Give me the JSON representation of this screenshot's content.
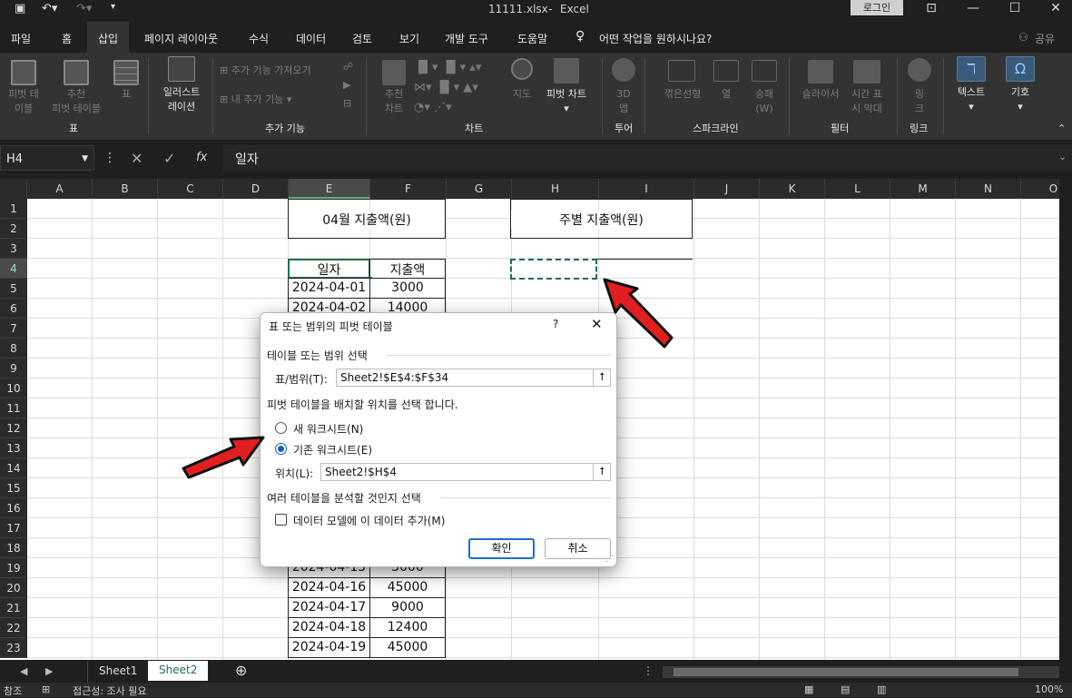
{
  "window": {
    "title_file": "11111.xlsx",
    "title_sep": "-",
    "title_app": "Excel",
    "login_label": "로그인"
  },
  "menu": {
    "items": [
      "파일",
      "홈",
      "삽입",
      "페이지 레이아웃",
      "수식",
      "데이터",
      "검토",
      "보기",
      "개발 도구",
      "도움말"
    ],
    "active": "삽입",
    "tell_me": "어떤 작업을 원하시나요?",
    "share": "공유"
  },
  "ribbon": {
    "pivot_table": "피벗 테\n이블",
    "recommended_pivot": "추천\n피벗 테이블",
    "table": "표",
    "illustrations": "일러스트\n레이션",
    "get_addins": "추가 기능 가져오기",
    "my_addins": "내 추가 기능",
    "recommended_charts": "추천\n차트",
    "maps": "지도",
    "pivot_chart": "피벗 차트",
    "map3d": "3D\n맵",
    "line": "꺾은선형",
    "column": "열",
    "winloss": "승패\n(W)",
    "slicer": "슬라이서",
    "timeline": "시간 표\n시 막대",
    "link": "링\n크",
    "text": "텍스트",
    "symbols": "기호",
    "groups": {
      "tables": "표",
      "addins": "추가 기능",
      "charts": "차트",
      "tours": "투어",
      "sparklines": "스파크라인",
      "filters": "필터",
      "links": "링크"
    }
  },
  "formula_bar": {
    "name_box": "H4",
    "fx": "fx",
    "content": "일자"
  },
  "grid": {
    "columns": [
      "A",
      "B",
      "C",
      "D",
      "E",
      "F",
      "G",
      "H",
      "I",
      "J",
      "K",
      "L",
      "M",
      "N",
      "O"
    ],
    "rows": [
      "1",
      "2",
      "3",
      "4",
      "5",
      "6",
      "7",
      "8",
      "9",
      "10",
      "11",
      "12",
      "13",
      "14",
      "15",
      "16",
      "17",
      "18",
      "19",
      "20",
      "21",
      "22",
      "23"
    ],
    "title_left": "04월 지출액(원)",
    "title_right": "주별 지출액(원)",
    "header_date": "일자",
    "header_amount": "지출액",
    "data_top": [
      {
        "date": "2024-04-01",
        "amount": "3000"
      },
      {
        "date": "2024-04-02",
        "amount": "14000"
      }
    ],
    "data_bottom": [
      {
        "date": "2024-04-15",
        "amount": "3000"
      },
      {
        "date": "2024-04-16",
        "amount": "45000"
      },
      {
        "date": "2024-04-17",
        "amount": "9000"
      },
      {
        "date": "2024-04-18",
        "amount": "12400"
      },
      {
        "date": "2024-04-19",
        "amount": "45000"
      }
    ]
  },
  "dialog": {
    "title": "표 또는 범위의 피벗 테이블",
    "help": "?",
    "section1": "테이블 또는 범위 선택",
    "range_label": "표/범위(T):",
    "range_value": "Sheet2!$E$4:$F$34",
    "section2": "피벗 테이블을 배치할 위치를 선택 합니다.",
    "opt_new": "새 워크시트(N)",
    "opt_existing": "기존 워크시트(E)",
    "selected": "existing",
    "location_label": "위치(L):",
    "location_value": "Sheet2!$H$4",
    "section3": "여러 테이블을 분석할 것인지 선택",
    "data_model": "데이터 모델에 이 데이터 추가(M)",
    "data_model_checked": false,
    "ok": "확인",
    "cancel": "취소"
  },
  "sheets": {
    "tabs": [
      "Sheet1",
      "Sheet2"
    ],
    "active": "Sheet2"
  },
  "status": {
    "mode": "참조",
    "accessibility": "접근성: 조사 필요",
    "zoom": "100%"
  }
}
